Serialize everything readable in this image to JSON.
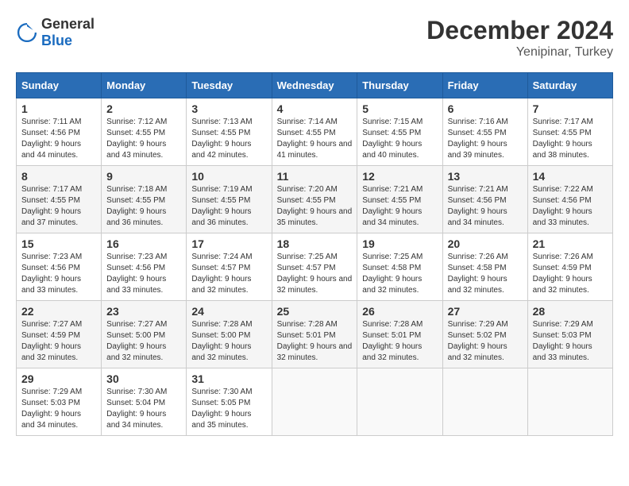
{
  "logo": {
    "general": "General",
    "blue": "Blue"
  },
  "header": {
    "month": "December 2024",
    "location": "Yenipinar, Turkey"
  },
  "weekdays": [
    "Sunday",
    "Monday",
    "Tuesday",
    "Wednesday",
    "Thursday",
    "Friday",
    "Saturday"
  ],
  "weeks": [
    [
      {
        "day": "1",
        "sunrise": "7:11 AM",
        "sunset": "4:56 PM",
        "daylight": "9 hours and 44 minutes."
      },
      {
        "day": "2",
        "sunrise": "7:12 AM",
        "sunset": "4:55 PM",
        "daylight": "9 hours and 43 minutes."
      },
      {
        "day": "3",
        "sunrise": "7:13 AM",
        "sunset": "4:55 PM",
        "daylight": "9 hours and 42 minutes."
      },
      {
        "day": "4",
        "sunrise": "7:14 AM",
        "sunset": "4:55 PM",
        "daylight": "9 hours and 41 minutes."
      },
      {
        "day": "5",
        "sunrise": "7:15 AM",
        "sunset": "4:55 PM",
        "daylight": "9 hours and 40 minutes."
      },
      {
        "day": "6",
        "sunrise": "7:16 AM",
        "sunset": "4:55 PM",
        "daylight": "9 hours and 39 minutes."
      },
      {
        "day": "7",
        "sunrise": "7:17 AM",
        "sunset": "4:55 PM",
        "daylight": "9 hours and 38 minutes."
      }
    ],
    [
      {
        "day": "8",
        "sunrise": "7:17 AM",
        "sunset": "4:55 PM",
        "daylight": "9 hours and 37 minutes."
      },
      {
        "day": "9",
        "sunrise": "7:18 AM",
        "sunset": "4:55 PM",
        "daylight": "9 hours and 36 minutes."
      },
      {
        "day": "10",
        "sunrise": "7:19 AM",
        "sunset": "4:55 PM",
        "daylight": "9 hours and 36 minutes."
      },
      {
        "day": "11",
        "sunrise": "7:20 AM",
        "sunset": "4:55 PM",
        "daylight": "9 hours and 35 minutes."
      },
      {
        "day": "12",
        "sunrise": "7:21 AM",
        "sunset": "4:55 PM",
        "daylight": "9 hours and 34 minutes."
      },
      {
        "day": "13",
        "sunrise": "7:21 AM",
        "sunset": "4:56 PM",
        "daylight": "9 hours and 34 minutes."
      },
      {
        "day": "14",
        "sunrise": "7:22 AM",
        "sunset": "4:56 PM",
        "daylight": "9 hours and 33 minutes."
      }
    ],
    [
      {
        "day": "15",
        "sunrise": "7:23 AM",
        "sunset": "4:56 PM",
        "daylight": "9 hours and 33 minutes."
      },
      {
        "day": "16",
        "sunrise": "7:23 AM",
        "sunset": "4:56 PM",
        "daylight": "9 hours and 33 minutes."
      },
      {
        "day": "17",
        "sunrise": "7:24 AM",
        "sunset": "4:57 PM",
        "daylight": "9 hours and 32 minutes."
      },
      {
        "day": "18",
        "sunrise": "7:25 AM",
        "sunset": "4:57 PM",
        "daylight": "9 hours and 32 minutes."
      },
      {
        "day": "19",
        "sunrise": "7:25 AM",
        "sunset": "4:58 PM",
        "daylight": "9 hours and 32 minutes."
      },
      {
        "day": "20",
        "sunrise": "7:26 AM",
        "sunset": "4:58 PM",
        "daylight": "9 hours and 32 minutes."
      },
      {
        "day": "21",
        "sunrise": "7:26 AM",
        "sunset": "4:59 PM",
        "daylight": "9 hours and 32 minutes."
      }
    ],
    [
      {
        "day": "22",
        "sunrise": "7:27 AM",
        "sunset": "4:59 PM",
        "daylight": "9 hours and 32 minutes."
      },
      {
        "day": "23",
        "sunrise": "7:27 AM",
        "sunset": "5:00 PM",
        "daylight": "9 hours and 32 minutes."
      },
      {
        "day": "24",
        "sunrise": "7:28 AM",
        "sunset": "5:00 PM",
        "daylight": "9 hours and 32 minutes."
      },
      {
        "day": "25",
        "sunrise": "7:28 AM",
        "sunset": "5:01 PM",
        "daylight": "9 hours and 32 minutes."
      },
      {
        "day": "26",
        "sunrise": "7:28 AM",
        "sunset": "5:01 PM",
        "daylight": "9 hours and 32 minutes."
      },
      {
        "day": "27",
        "sunrise": "7:29 AM",
        "sunset": "5:02 PM",
        "daylight": "9 hours and 32 minutes."
      },
      {
        "day": "28",
        "sunrise": "7:29 AM",
        "sunset": "5:03 PM",
        "daylight": "9 hours and 33 minutes."
      }
    ],
    [
      {
        "day": "29",
        "sunrise": "7:29 AM",
        "sunset": "5:03 PM",
        "daylight": "9 hours and 34 minutes."
      },
      {
        "day": "30",
        "sunrise": "7:30 AM",
        "sunset": "5:04 PM",
        "daylight": "9 hours and 34 minutes."
      },
      {
        "day": "31",
        "sunrise": "7:30 AM",
        "sunset": "5:05 PM",
        "daylight": "9 hours and 35 minutes."
      },
      null,
      null,
      null,
      null
    ]
  ],
  "labels": {
    "sunrise": "Sunrise:",
    "sunset": "Sunset:",
    "daylight": "Daylight:"
  }
}
